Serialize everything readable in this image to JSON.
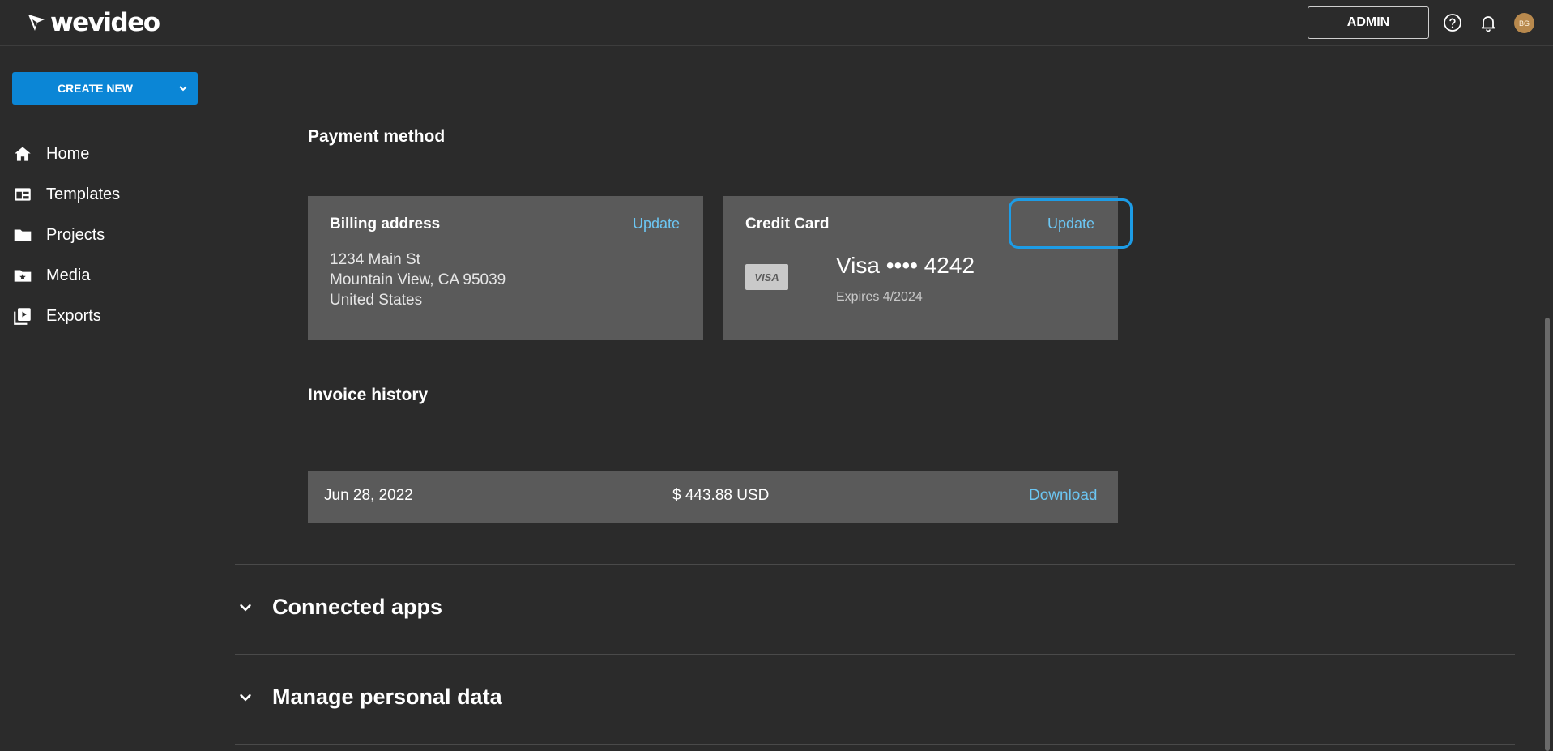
{
  "app": {
    "logo_text": "wevideo",
    "admin_label": "ADMIN",
    "avatar_initials": "BG",
    "icons": [
      "help-circle-icon",
      "bell-icon"
    ]
  },
  "sidebar": {
    "create_label": "CREATE NEW",
    "items": [
      {
        "label": "Home",
        "icon": "home-icon"
      },
      {
        "label": "Templates",
        "icon": "templates-icon"
      },
      {
        "label": "Projects",
        "icon": "folder-icon"
      },
      {
        "label": "Media",
        "icon": "media-folder-icon"
      },
      {
        "label": "Exports",
        "icon": "exports-icon"
      }
    ]
  },
  "payment": {
    "title": "Payment method",
    "billing": {
      "title": "Billing address",
      "update_label": "Update",
      "line1": "1234 Main St",
      "line2": "Mountain View, CA 95039",
      "line3": "United States"
    },
    "card": {
      "title": "Credit Card",
      "update_label": "Update",
      "brand_badge": "VISA",
      "number": "Visa •••• 4242",
      "expires": "Expires 4/2024"
    }
  },
  "invoices": {
    "title": "Invoice history",
    "rows": [
      {
        "date": "Jun 28, 2022",
        "amount": "$ 443.88 USD",
        "action": "Download"
      }
    ]
  },
  "accordions": [
    {
      "label": "Connected apps"
    },
    {
      "label": "Manage personal data"
    }
  ],
  "colors": {
    "background": "#2b2b2b",
    "card": "#5a5a5a",
    "accent": "#0b86d6",
    "link": "#6cc6f3",
    "highlight": "#1d9ce6"
  }
}
